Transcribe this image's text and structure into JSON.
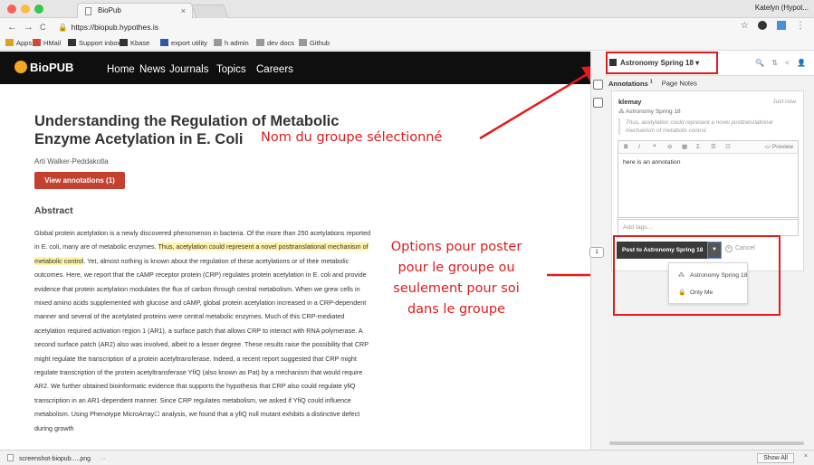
{
  "browser": {
    "tab_title": "BioPub",
    "tab_close": "×",
    "profile": "Katelyn (Hypot...",
    "nav": {
      "back": "←",
      "forward": "→",
      "reload": "C"
    },
    "url": "https://biopub.hypothes.is",
    "star": "☆",
    "bookmarks": [
      {
        "label": "Apps",
        "icon_color": "#e0a020"
      },
      {
        "label": "HMail",
        "icon_color": "#d44638"
      },
      {
        "label": "Support inbox",
        "icon_color": "#333333"
      },
      {
        "label": "Kbase",
        "icon_color": "#333333"
      },
      {
        "label": "export utility",
        "icon_color": "#3355aa"
      },
      {
        "label": "h admin",
        "icon_color": "#999999"
      },
      {
        "label": "dev docs",
        "icon_color": "#999999"
      },
      {
        "label": "Github",
        "icon_color": "#999999"
      }
    ]
  },
  "site": {
    "logo": {
      "prefix": "Bio",
      "suffix": "PUB"
    },
    "nav": [
      "Home",
      "News",
      "Journals",
      "Topics",
      "Careers"
    ],
    "accent": "#c4402f"
  },
  "article": {
    "title": "Understanding the Regulation of Metabolic Enzyme Acetylation in E. Coli",
    "author": "Arti Walker-Peddakotla",
    "view_button": "View annotations (1)",
    "abstract_heading": "Abstract",
    "abstract_before": "Global protein acetylation is a newly discovered phenomenon in bacteria. Of the more than 250 acetylations reported in E. coli, many are of metabolic enzymes. ",
    "abstract_highlight": "Thus, acetylation could represent a novel posttranslational mechanism of metabolic control",
    "abstract_after": ". Yet, almost nothing is known about the regulation of these acetylations or of their metabolic outcomes. Here, we report that the cAMP receptor protein (CRP) regulates protein acetylation in E. coli and provide evidence that protein acetylation modulates the flux of carbon through central metabolism. When we grew cells in mixed amino acids supplemented with glucose and cAMP, global protein acetylation increased in a CRP-dependent manner and several of the acetylated proteins were central metabolic enzymes. Much of this CRP-mediated acetylation required activation region 1 (AR1), a surface patch that allows CRP to interact with RNA polymerase. A second surface patch (AR2) also was involved, albeit to a lesser degree. These results raise the possibility that CRP might regulate the transcription of a protein acetyltransferase. Indeed, a recent report suggested that CRP might regulate transcription of the protein acetyltransferase YfiQ (also known as Pat) by a mechanism that would require AR2. We further obtained bioinformatic evidence that supports the hypothesis that CRP also could regulate yfiQ transcription in an AR1-dependent manner. Since CRP regulates metabolism, we asked if YfiQ could influence metabolism. Using Phenotype MicroArray☐ analysis, we found that a yfiQ null mutant exhibits a distinctive defect during growth"
  },
  "callouts": {
    "group_name": "Nom du groupe sélectionné",
    "options": [
      "Options pour poster",
      "pour le groupe ou",
      "seulement pour soi",
      "dans le groupe"
    ],
    "color": "#e21a1a"
  },
  "sidebar": {
    "group": "Astronomy Spring 18",
    "caret": "▾",
    "tools": "🔍 ⇅ < 👤",
    "strip_count": "1",
    "tabs": {
      "annotations": "Annotations",
      "annotations_count": "1",
      "page_notes": "Page Notes"
    },
    "annotation": {
      "user": "klemay",
      "time": "Just now",
      "group": "Astronomy Spring 18",
      "quote": "Thus, acetylation could represent a novel posttranslational mechanism of metabolic control.",
      "text": "here is an annotation"
    },
    "editor_tools": [
      "B",
      "I",
      "❝",
      "⊖",
      "▦",
      "Σ",
      "☰",
      "☷"
    ],
    "preview": "Preview",
    "tags_placeholder": "Add tags…",
    "post_button": "Post to Astronomy Spring 18",
    "dropdown_arrow": "▼",
    "cancel": "Cancel",
    "post_options": [
      {
        "icon": "people-icon",
        "glyph": "⁂",
        "label": "Astronomy Spring 18"
      },
      {
        "icon": "lock-icon",
        "glyph": "🔒",
        "label": "Only Me"
      }
    ]
  },
  "downloads": {
    "file": "screenshot-biopub.....png",
    "more": "···",
    "show_all": "Show All",
    "close": "×"
  }
}
